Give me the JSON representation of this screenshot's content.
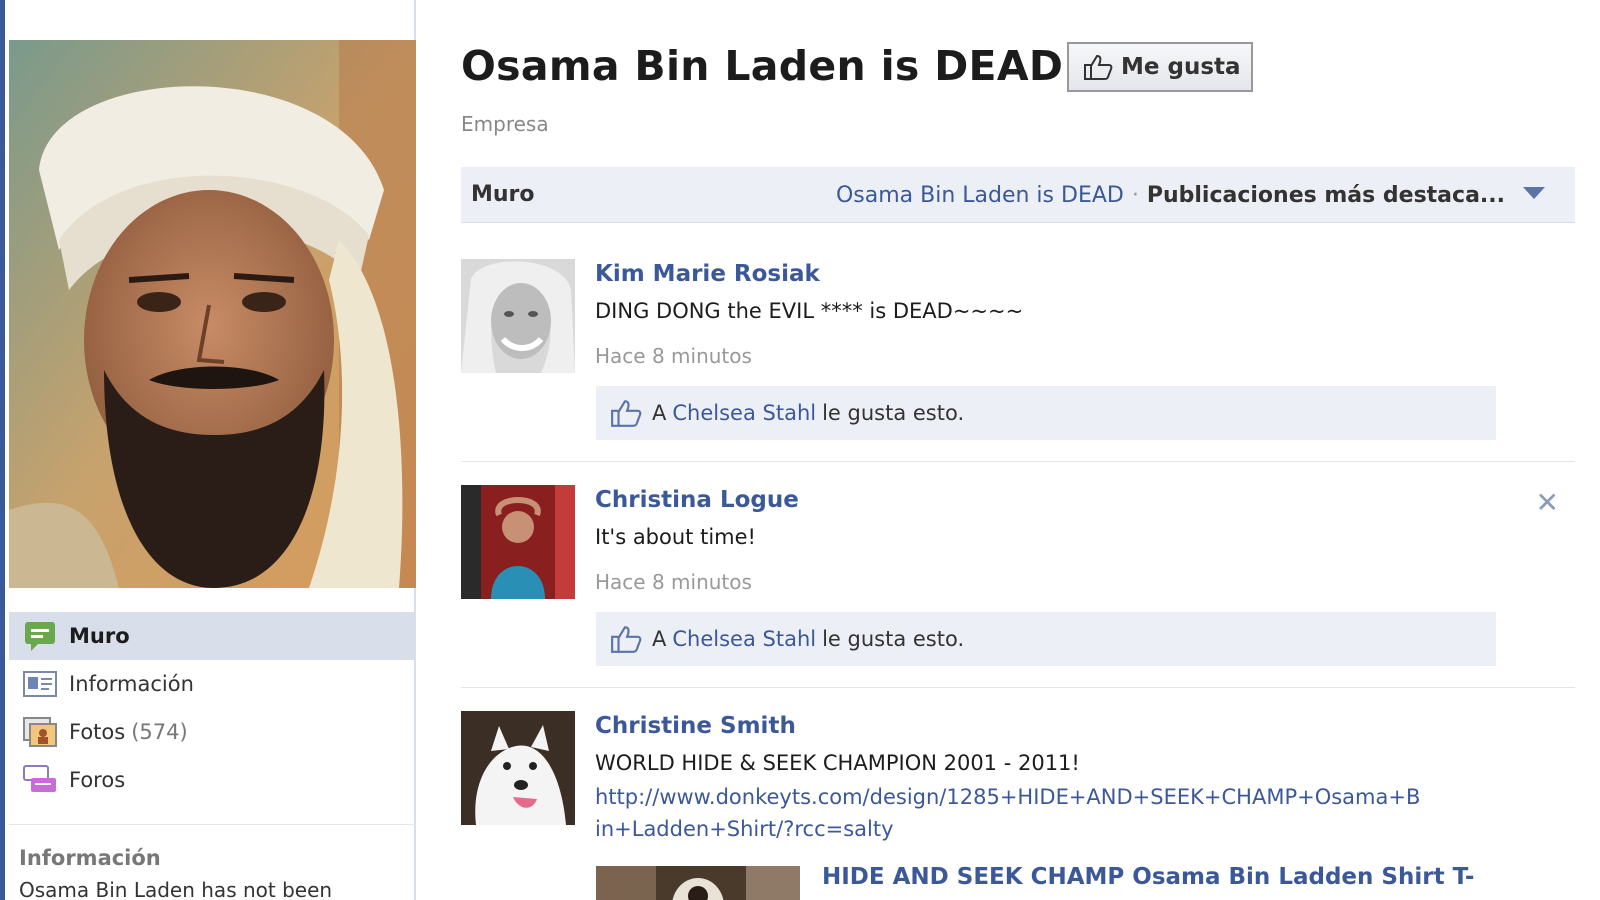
{
  "sidebar": {
    "items": [
      {
        "label": "Muro",
        "icon": "wall-icon",
        "active": true,
        "count": ""
      },
      {
        "label": "Información",
        "icon": "info-icon",
        "active": false,
        "count": ""
      },
      {
        "label": "Fotos",
        "icon": "photos-icon",
        "active": false,
        "count": "(574)"
      },
      {
        "label": "Foros",
        "icon": "forums-icon",
        "active": false,
        "count": ""
      }
    ],
    "info_title": "Información",
    "info_text": "Osama Bin Laden has not been"
  },
  "header": {
    "title": "Osama Bin Laden is DEAD",
    "like_button": "Me gusta",
    "category": "Empresa"
  },
  "wall_bar": {
    "title": "Muro",
    "page_link": "Osama Bin Laden is DEAD",
    "separator": "·",
    "filter": "Publicaciones más destaca..."
  },
  "posts": [
    {
      "author": "Kim Marie Rosiak",
      "text": "DING DONG the EVIL **** is DEAD~~~~",
      "time": "Hace 8 minutos",
      "like_prefix": "A",
      "liker": "Chelsea Stahl",
      "like_suffix": "le gusta esto."
    },
    {
      "author": "Christina Logue",
      "text": "It's about time!",
      "time": "Hace 8 minutos",
      "like_prefix": "A",
      "liker": "Chelsea Stahl",
      "like_suffix": "le gusta esto.",
      "close": "✕"
    },
    {
      "author": "Christine Smith",
      "text": "WORLD HIDE & SEEK CHAMPION 2001 - 2011!",
      "link": "http://www.donkeyts.com/design/1285+HIDE+AND+SEEK+CHAMP+Osama+Bin+Ladden+Shirt/?rcc=salty",
      "attachment_title": "HIDE AND SEEK CHAMP Osama Bin Ladden Shirt T-"
    }
  ],
  "colors": {
    "brand": "#3b5998",
    "nav_active": "#d8dfea",
    "bar_bg": "#eceff5"
  }
}
